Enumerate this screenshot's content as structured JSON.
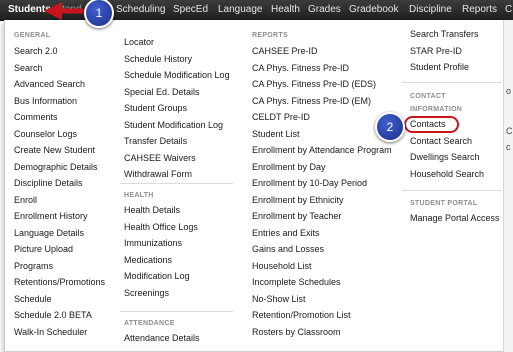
{
  "nav": {
    "items": [
      "Students",
      "Scheduling",
      "SpecEd",
      "Language",
      "Health",
      "Grades",
      "Gradebook",
      "Discipline",
      "Reports",
      "C"
    ],
    "hidden_fragment": "tend"
  },
  "callouts": {
    "one": "1",
    "two": "2"
  },
  "columns": {
    "general": {
      "header": "GENERAL",
      "items": [
        "Search 2.0",
        "Search",
        "Advanced Search",
        "Bus Information",
        "Comments",
        "Counselor Logs",
        "Create New Student",
        "Demographic Details",
        "Discipline Details",
        "Enroll",
        "Enrollment History",
        "Language Details",
        "Picture Upload",
        "Programs",
        "Retentions/Promotions",
        "Schedule",
        "Schedule 2.0 BETA",
        "Walk-In Scheduler"
      ]
    },
    "col2": {
      "items": [
        "Locator",
        "Schedule History",
        "Schedule Modification Log",
        "Special Ed. Details",
        "Student Groups",
        "Student Modification Log",
        "Transfer Details",
        "CAHSEE Waivers",
        "Withdrawal Form"
      ]
    },
    "health": {
      "header": "HEALTH",
      "items": [
        "Health Details",
        "Health Office Logs",
        "Immunizations",
        "Medications",
        "Modification Log",
        "Screenings"
      ]
    },
    "attendance": {
      "header": "ATTENDANCE",
      "items": [
        "Attendance Details"
      ]
    },
    "reports": {
      "header": "REPORTS",
      "items": [
        "CAHSEE Pre-ID",
        "CA Phys. Fitness Pre-ID",
        "CA Phys. Fitness Pre-ID (EDS)",
        "CA Phys. Fitness Pre-ID (EM)",
        "CELDT Pre-ID",
        "Student List",
        "Enrollment by Attendance Program",
        "Enrollment by Day",
        "Enrollment by 10-Day Period",
        "Enrollment by Ethnicity",
        "Enrollment by Teacher",
        "Entries and Exits",
        "Gains and Losses",
        "Household List",
        "Incomplete Schedules",
        "No-Show List",
        "Retention/Promotion List",
        "Rosters by Classroom"
      ]
    },
    "col4": {
      "items": [
        "Search Transfers",
        "STAR Pre-ID",
        "Student Profile"
      ]
    },
    "contact": {
      "header_line1": "CONTACT",
      "header_line2": "INFORMATION",
      "items": [
        "Contacts",
        "Contact Search",
        "Dwellings Search",
        "Household Search"
      ]
    },
    "portal": {
      "header": "STUDENT PORTAL",
      "items": [
        "Manage Portal Access"
      ]
    }
  },
  "right_edge_fragments": [
    "o",
    "C",
    "c"
  ],
  "colors": {
    "callout_blue": "#2a44b0",
    "highlight_red": "#c8141a",
    "arrow_red": "#c8141a"
  }
}
